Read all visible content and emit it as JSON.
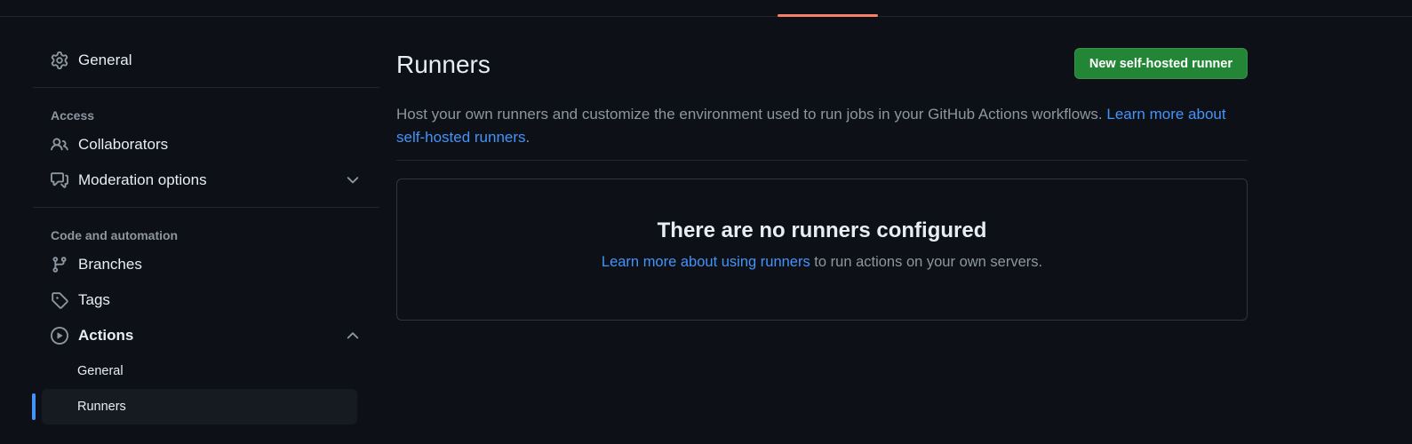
{
  "sidebar": {
    "general": "General",
    "access_title": "Access",
    "collaborators": "Collaborators",
    "moderation": "Moderation options",
    "code_title": "Code and automation",
    "branches": "Branches",
    "tags": "Tags",
    "actions": "Actions",
    "actions_general": "General",
    "actions_runners": "Runners"
  },
  "main": {
    "title": "Runners",
    "new_button": "New self-hosted runner",
    "description": "Host your own runners and customize the environment used to run jobs in your GitHub Actions workflows. ",
    "description_link": "Learn more about self-hosted runners",
    "description_end": ".",
    "empty_title": "There are no runners configured",
    "empty_link": "Learn more about using runners",
    "empty_text": " to run actions on your own servers."
  },
  "colors": {
    "accent": "#4493f8",
    "primary_button": "#238636",
    "tab_underline": "#f78166"
  }
}
